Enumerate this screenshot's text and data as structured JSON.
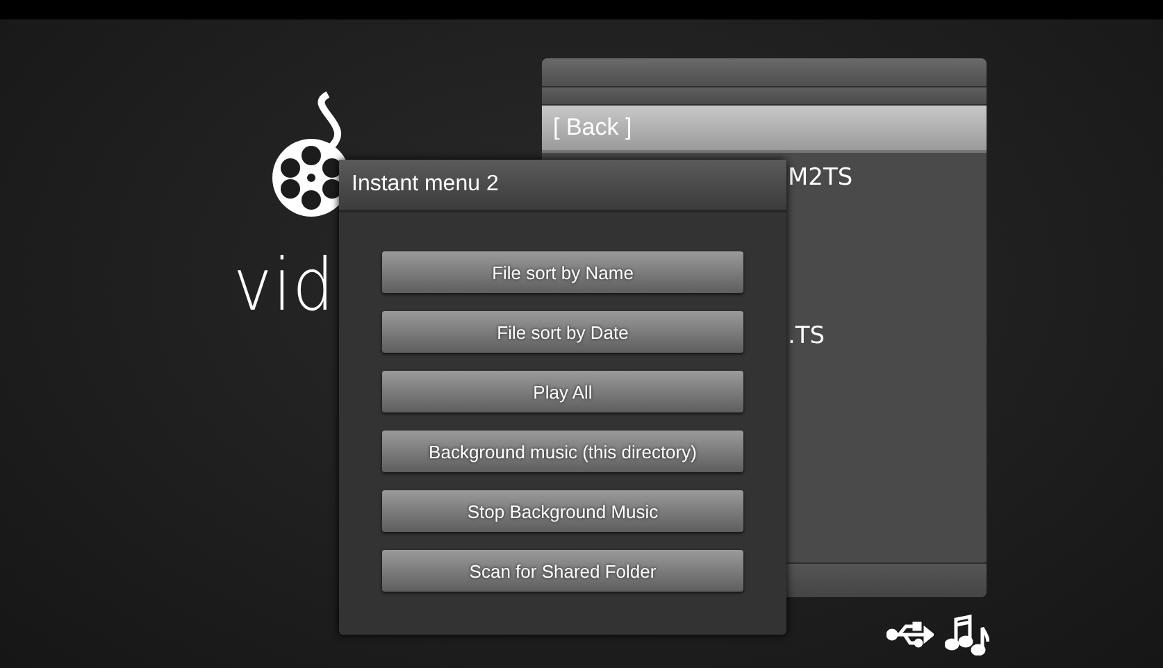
{
  "logo": {
    "text": "vid"
  },
  "file_list": {
    "rows": [
      {
        "name": "[ Back ]",
        "kind": "full",
        "selected": true
      },
      {
        "name": "M2TS",
        "kind": "partial",
        "selected": false
      },
      {
        "name": ".TS",
        "kind": "partial",
        "selected": false
      }
    ]
  },
  "instant_menu": {
    "title": "Instant menu 2",
    "buttons": [
      "File sort by Name",
      "File sort by Date",
      "Play All",
      "Background music (this directory)",
      "Stop Background Music",
      "Scan for Shared Folder"
    ]
  }
}
